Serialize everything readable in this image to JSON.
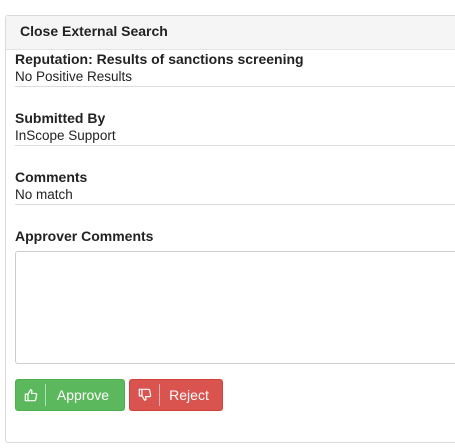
{
  "panel": {
    "title": "Close External Search"
  },
  "fields": [
    {
      "label": "Reputation: Results of sanctions screening",
      "value": "No Positive Results"
    },
    {
      "label": "Submitted By",
      "value": "InScope Support"
    },
    {
      "label": "Comments",
      "value": "No match"
    }
  ],
  "approver": {
    "label": "Approver Comments",
    "value": ""
  },
  "actions": {
    "approve_label": "Approve",
    "approve_icon": "thumbs-up-icon",
    "reject_label": "Reject",
    "reject_icon": "thumbs-down-icon"
  },
  "colors": {
    "approve": "#5cb85c",
    "reject": "#d9534f",
    "header_bg": "#f5f5f5"
  }
}
